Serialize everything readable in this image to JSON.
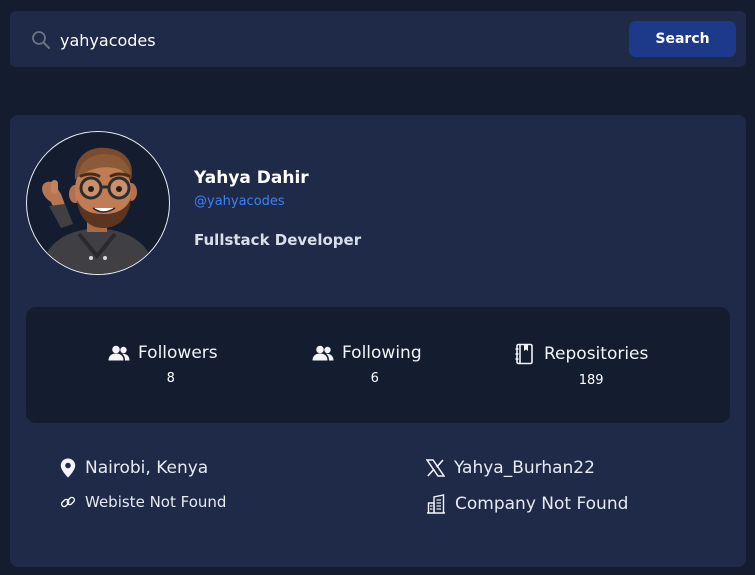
{
  "search": {
    "value": "yahyacodes",
    "button_label": "Search"
  },
  "profile": {
    "name": "Yahya Dahir",
    "handle": "@yahyacodes",
    "bio": "Fullstack Developer",
    "avatar_icon": "memoji-avatar"
  },
  "stats": {
    "followers": {
      "label": "Followers",
      "value": "8",
      "icon": "users-icon"
    },
    "following": {
      "label": "Following",
      "value": "6",
      "icon": "users-icon"
    },
    "repositories": {
      "label": "Repositories",
      "value": "189",
      "icon": "book-icon"
    }
  },
  "info": {
    "location": "Nairobi, Kenya",
    "website": "Webiste Not Found",
    "twitter": "Yahya_Burhan22",
    "company": "Company Not Found"
  },
  "colors": {
    "background": "#141c2f",
    "card": "#1f2a48",
    "accent_button": "#1d3a8a",
    "handle_link": "#3b82f6"
  }
}
